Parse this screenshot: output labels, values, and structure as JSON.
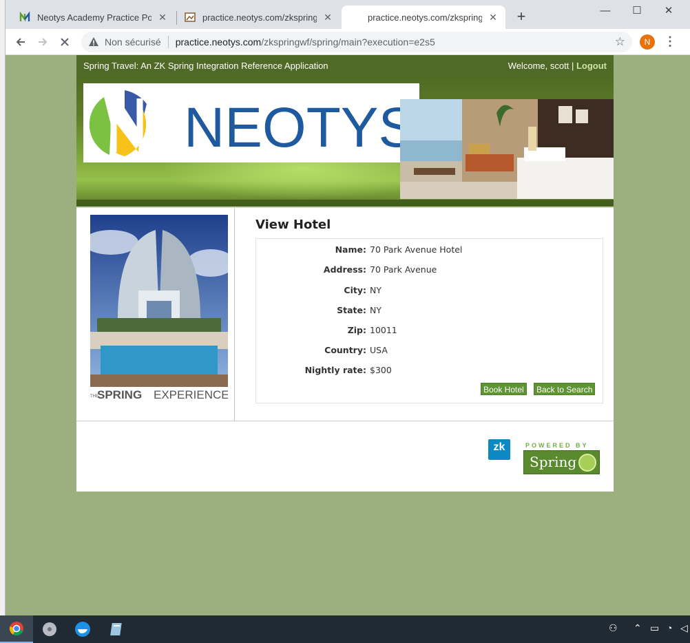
{
  "browser": {
    "tabs": [
      {
        "label": "Neotys Academy Practice Portal"
      },
      {
        "label": "practice.neotys.com/zkspringwf/s"
      },
      {
        "label": "practice.neotys.com/zkspringwf/s"
      }
    ],
    "new_tab": "+",
    "address": {
      "security": "Non sécurisé",
      "host": "practice.neotys.com",
      "path": "/zkspringwf/spring/main?execution=e2s5"
    },
    "profile_initial": "N"
  },
  "site": {
    "app_title": "Spring Travel: An ZK Spring Integration Reference Application",
    "welcome": "Welcome, scott | ",
    "logout": "Logout",
    "logo_text": "NEOTYS",
    "hotel_caption_small": "THE",
    "hotel_caption_bold": "SPRING",
    "hotel_caption_rest": "EXPERIENCE"
  },
  "view_hotel": {
    "title": "View Hotel",
    "fields": [
      {
        "label": "Name:",
        "value": "70 Park Avenue Hotel"
      },
      {
        "label": "Address:",
        "value": "70 Park Avenue"
      },
      {
        "label": "City:",
        "value": "NY"
      },
      {
        "label": "State:",
        "value": "NY"
      },
      {
        "label": "Zip:",
        "value": "10011"
      },
      {
        "label": "Country:",
        "value": "USA"
      },
      {
        "label": "Nightly rate:",
        "value": "$300"
      }
    ],
    "book_button": "Book Hotel",
    "back_button": "Back to Search"
  },
  "footer": {
    "zk_label": "zk",
    "powered_by": "POWERED BY",
    "spring_label": "Spring"
  },
  "colors": {
    "page_bg": "#9caf7e",
    "header_green": "#4e6a26",
    "button_green": "#5e9434",
    "neotys_blue": "#1f5a9e"
  }
}
